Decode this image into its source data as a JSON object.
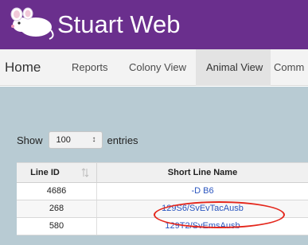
{
  "header": {
    "app_title": "Stuart Web",
    "bg_color": "#6a2f8d",
    "logo_icon": "mouse-logo-icon"
  },
  "nav": {
    "items": [
      {
        "label": "Home"
      },
      {
        "label": "Reports"
      },
      {
        "label": "Colony View"
      },
      {
        "label": "Animal View",
        "active": true
      },
      {
        "label": "Comm"
      }
    ]
  },
  "table_controls": {
    "show_label": "Show",
    "entries_value": "100",
    "entries_arrows": "↕",
    "entries_label": "entries"
  },
  "table": {
    "columns": [
      "Line ID",
      "Short Line Name"
    ],
    "sort_icon": "sort-icon",
    "rows": [
      {
        "line_id": "4686",
        "short_line_name": "-D B6"
      },
      {
        "line_id": "268",
        "short_line_name": "129S6/SvEvTacAusb",
        "highlighted": true
      },
      {
        "line_id": "580",
        "short_line_name": "129T2/SvEmsAusb"
      }
    ]
  },
  "colors": {
    "content_bg": "#b8cbd3",
    "link": "#2a55bf",
    "highlight": "#e4261b"
  }
}
